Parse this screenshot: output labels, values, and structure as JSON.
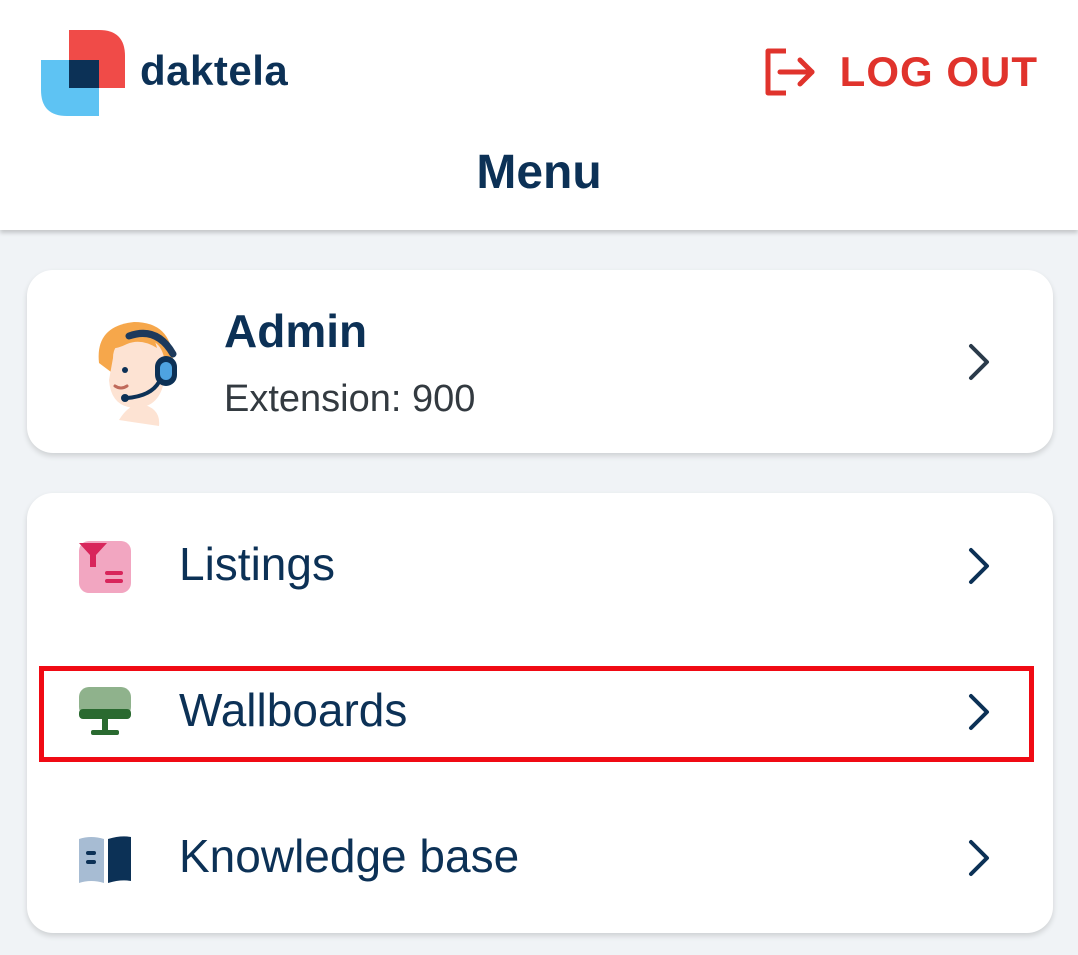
{
  "header": {
    "logo_text": "daktela",
    "logout_label": "LOG OUT",
    "title": "Menu"
  },
  "profile": {
    "name": "Admin",
    "extension": "Extension: 900"
  },
  "menu": {
    "items": [
      {
        "label": "Listings",
        "icon": "listings-icon"
      },
      {
        "label": "Wallboards",
        "icon": "monitor-icon"
      },
      {
        "label": "Knowledge base",
        "icon": "book-icon"
      }
    ]
  },
  "colors": {
    "brand_navy": "#0c3156",
    "logout_red": "#e0332c",
    "highlight_red": "#f00a14",
    "background": "#f0f3f6"
  }
}
